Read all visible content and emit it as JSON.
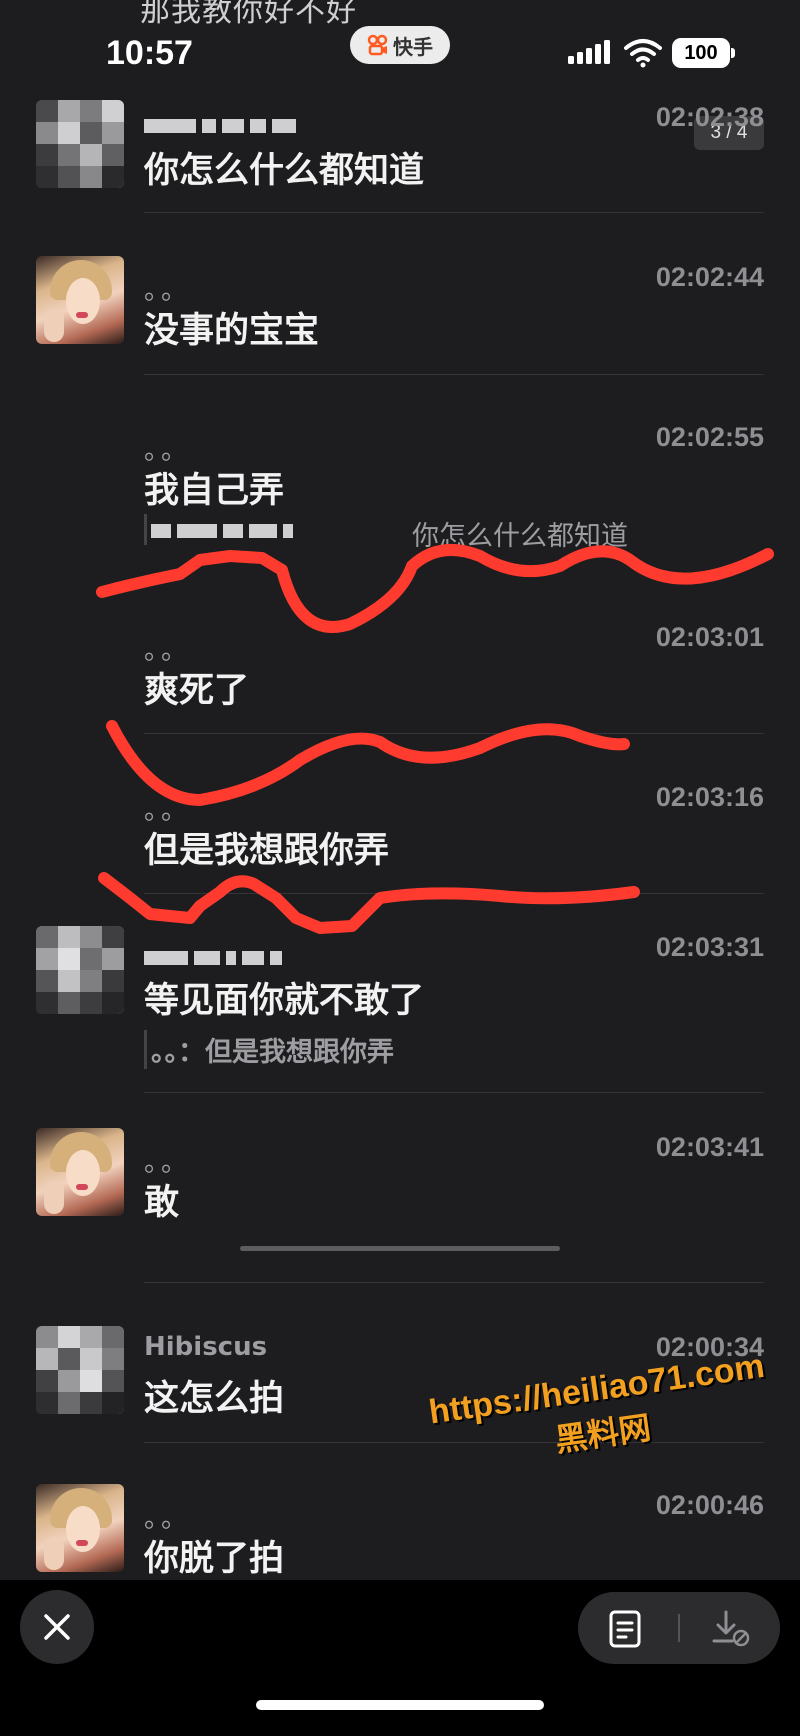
{
  "status_bar": {
    "time": "10:57",
    "app_name": "快手",
    "battery": "100",
    "partial_header_text": "那我教你好不好"
  },
  "page_indicator": "3 / 4",
  "messages": [
    {
      "sender": "pixelated",
      "name": "",
      "time": "02:02:38",
      "text": "你怎么什么都知道",
      "quote": ""
    },
    {
      "sender": "girl",
      "name": "。。",
      "time": "02:02:44",
      "text": "没事的宝宝",
      "quote": ""
    },
    {
      "sender": "none",
      "name": "。。",
      "time": "02:02:55",
      "text": "我自己弄",
      "quote": "你怎么什么都知道"
    },
    {
      "sender": "none",
      "name": "。。",
      "time": "02:03:01",
      "text": "爽死了",
      "quote": ""
    },
    {
      "sender": "none",
      "name": "。。",
      "time": "02:03:16",
      "text": "但是我想跟你弄",
      "quote": ""
    },
    {
      "sender": "pixelated",
      "name": "",
      "time": "02:03:31",
      "text": "等见面你就不敢了",
      "quote": "。。：但是我想跟你弄"
    },
    {
      "sender": "girl",
      "name": "。。",
      "time": "02:03:41",
      "text": "敢",
      "quote": ""
    },
    {
      "sender": "pixelated",
      "name": "Hibiscus",
      "time": "02:00:34",
      "text": "这怎么拍",
      "quote": ""
    },
    {
      "sender": "girl",
      "name": "。。",
      "time": "02:00:46",
      "text": "你脱了拍",
      "quote": ""
    }
  ],
  "watermark": {
    "url": "https://heiliao71.com",
    "site_name": "黑料网"
  },
  "bottom_bar": {
    "close_icon": "close-icon",
    "doc_icon": "document-icon",
    "download_icon": "download-disabled-icon"
  },
  "colors": {
    "background": "#1d1d1f",
    "scribble": "#ff3b2f",
    "watermark": "#f3a020"
  }
}
